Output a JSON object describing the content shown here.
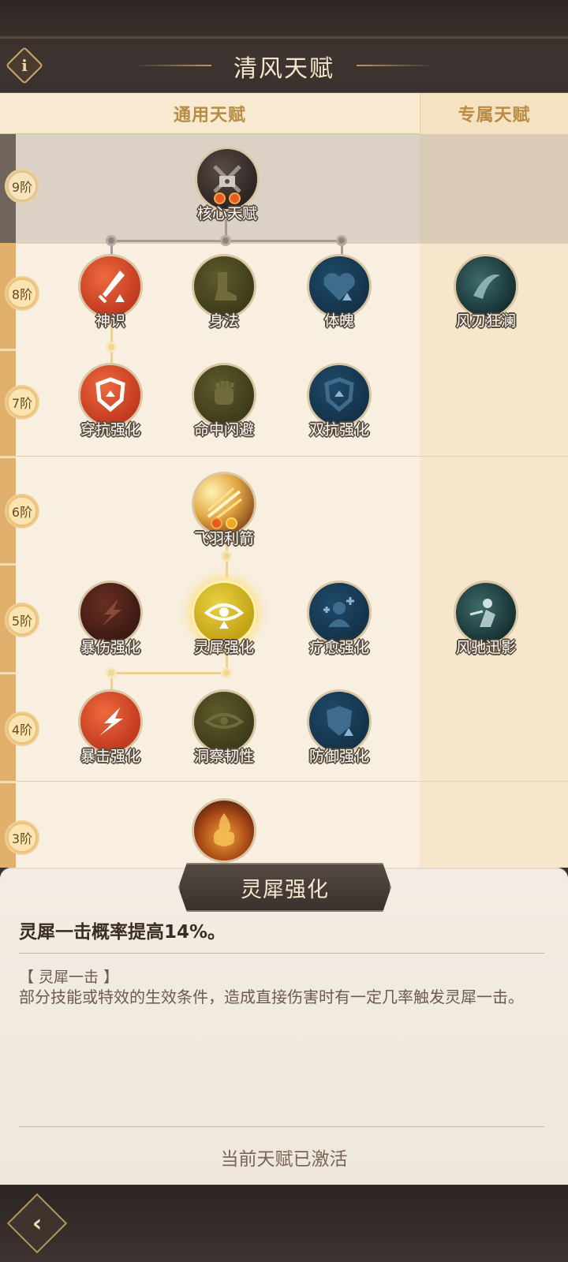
{
  "header": {
    "title": "清风天赋",
    "info_icon": "i"
  },
  "tabs": {
    "general": "通用天赋",
    "exclusive": "专属天赋"
  },
  "tiers": [
    "9阶",
    "8阶",
    "7阶",
    "6阶",
    "5阶",
    "4阶",
    "3阶"
  ],
  "nodes": {
    "core": "核心天赋",
    "shenshi": "神识",
    "shenfa": "身法",
    "tipo": "体魄",
    "fengren": "风刃狂澜",
    "chuankang": "穿抗强化",
    "mingzhong": "命中闪避",
    "shuangkang": "双抗强化",
    "feiyu": "飞羽利箭",
    "baoshang": "暴伤强化",
    "lingxi": "灵犀强化",
    "liaoyu": "疗愈强化",
    "fengchi": "风驰迅影",
    "baoji": "暴击强化",
    "dongcha": "洞察韧性",
    "fangyu": "防御强化"
  },
  "detail": {
    "title": "灵犀强化",
    "effect": "灵犀一击概率提高14%。",
    "keyword": "【 灵犀一击 】",
    "description": "部分技能或特效的生效条件，造成直接伤害时有一定几率触发灵犀一击。",
    "status": "当前天赋已激活"
  },
  "footer": {
    "back_icon": "back-arrow-icon"
  },
  "colors": {
    "accent_gold": "#b88c45",
    "active_glow": "#e8d245"
  }
}
